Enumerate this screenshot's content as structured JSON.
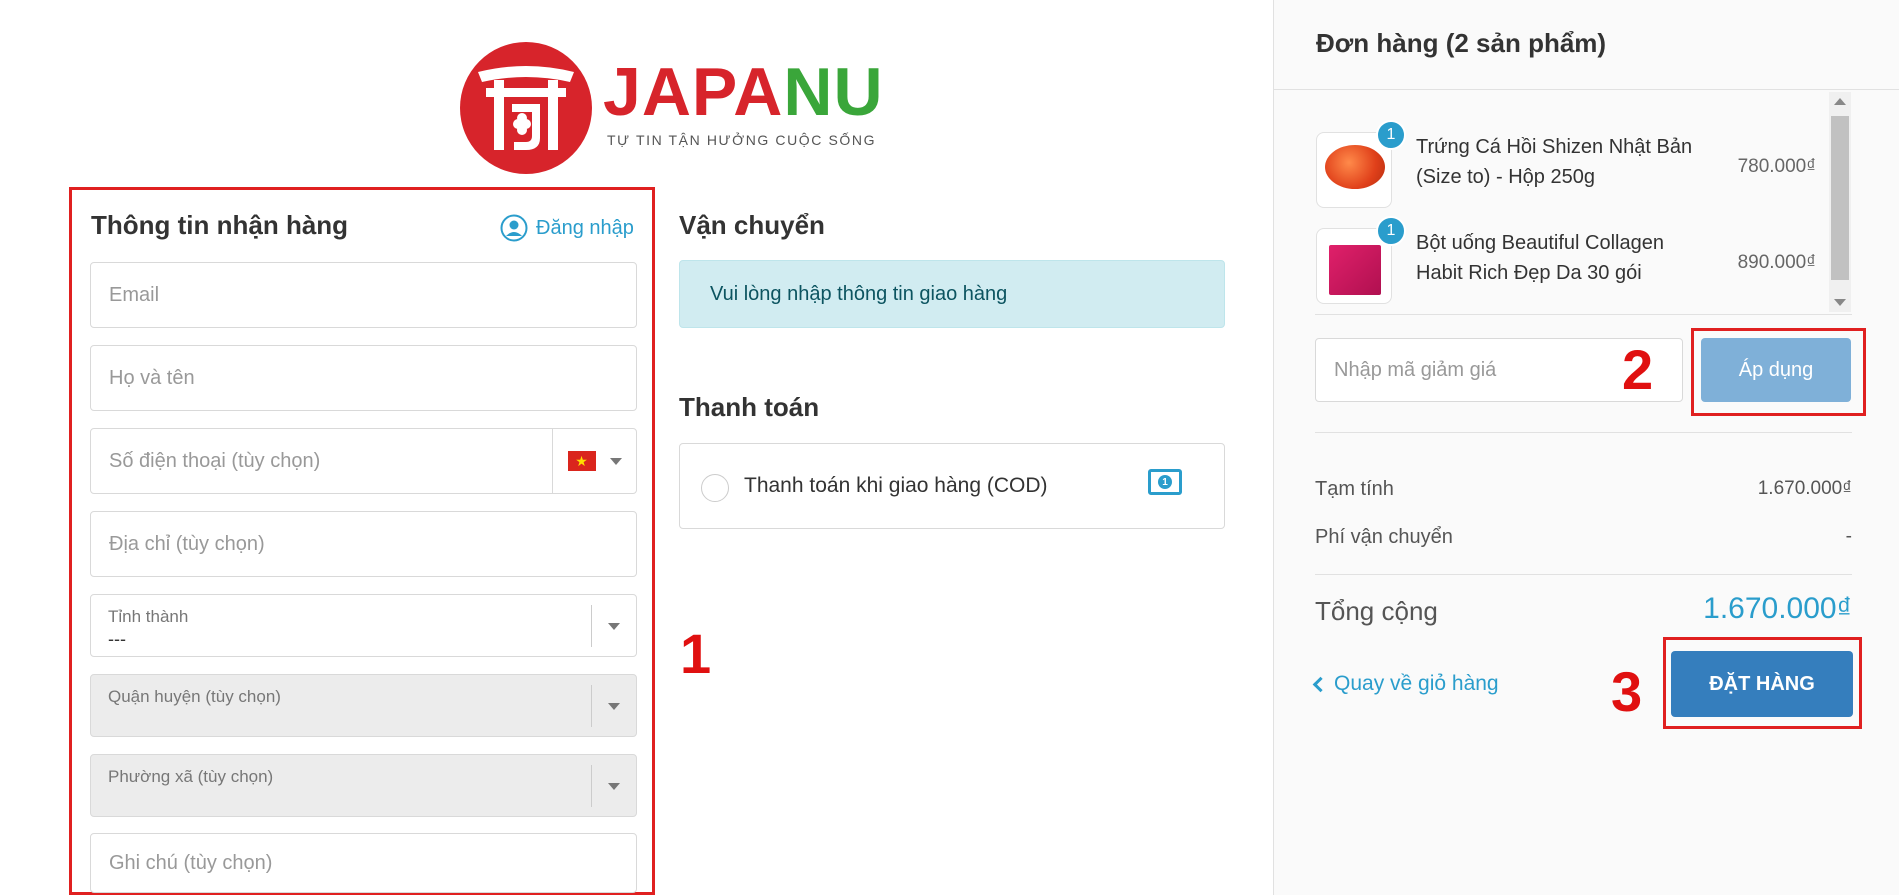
{
  "brand": {
    "name_part1": "JAPA",
    "name_part2": "NU",
    "tagline": "TỰ TIN TẬN HƯỞNG CUỘC SỐNG"
  },
  "shipping_info": {
    "title": "Thông tin nhận hàng",
    "login_label": "Đăng nhập",
    "email_placeholder": "Email",
    "name_placeholder": "Họ và tên",
    "phone_placeholder": "Số điện thoại (tùy chọn)",
    "address_placeholder": "Địa chỉ (tùy chọn)",
    "province_label": "Tỉnh thành",
    "province_value": "---",
    "district_label": "Quận huyện (tùy chọn)",
    "ward_label": "Phường xã (tùy chọn)",
    "note_placeholder": "Ghi chú (tùy chọn)"
  },
  "delivery": {
    "title": "Vận chuyển",
    "message": "Vui lòng nhập thông tin giao hàng"
  },
  "payment": {
    "title": "Thanh toán",
    "method_cod": "Thanh toán khi giao hàng (COD)"
  },
  "order": {
    "title": "Đơn hàng (2 sản phẩm)",
    "products": [
      {
        "name": "Trứng Cá Hồi Shizen Nhật Bản (Size to) - Hộp 250g",
        "price": "780.000₫",
        "quantity": "1"
      },
      {
        "name": "Bột uống Beautiful Collagen Habit Rich Đẹp Da 30 gói",
        "price": "890.000₫",
        "quantity": "1"
      }
    ],
    "coupon_placeholder": "Nhập mã giảm giá",
    "apply_label": "Áp dụng",
    "subtotal_label": "Tạm tính",
    "subtotal_value": "1.670.000₫",
    "shipping_fee_label": "Phí vận chuyển",
    "shipping_fee_value": "-",
    "total_label": "Tổng cộng",
    "total_value": "1.670.000₫",
    "back_label": "Quay về giỏ hàng",
    "place_order_label": "ĐẶT HÀNG"
  },
  "annotations": {
    "step1": "1",
    "step2": "2",
    "step3": "3"
  },
  "colors": {
    "accent": "#2a9dcc",
    "brand_red": "#d7242b",
    "brand_green": "#3aa63a",
    "highlight": "#e02020",
    "order_button": "#357ebd",
    "apply_button": "#7fb0d8"
  }
}
